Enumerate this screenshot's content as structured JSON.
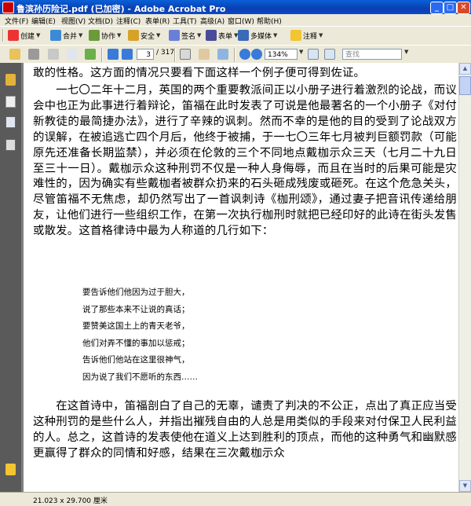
{
  "window": {
    "title": "鲁滨孙历险记.pdf (已加密) - Adobe Acrobat Pro",
    "minimize": "_",
    "maximize": "□",
    "close": "✕"
  },
  "menu": [
    "文件(F)",
    "编辑(E)",
    "视图(V)",
    "文档(D)",
    "注释(C)",
    "表单(R)",
    "工具(T)",
    "高级(A)",
    "窗口(W)",
    "帮助(H)"
  ],
  "toolbar1": {
    "create": "创建",
    "combine": "合并",
    "collaborate": "协作",
    "secure": "安全",
    "sign": "签名",
    "forms": "表单",
    "multimedia": "多媒体",
    "comment": "注释"
  },
  "toolbar2": {
    "page_current": "3",
    "page_total": "/ 317",
    "zoom": "134%",
    "search_placeholder": "查找"
  },
  "document": {
    "paragraphs": [
      "敢的性格。这方面的情况只要看下面这样一个例子便可得到佐证。",
      "　　一七〇二年十二月，英国的两个重要教派间正以小册子进行着激烈的论战，而议会中也正为此事进行着辩论，笛福在此时发表了可说是他最著名的一个小册子《对付新教徒的最简捷办法》，进行了辛辣的讽刺。然而不幸的是他的目的受到了论战双方的误解，在被追逃亡四个月后，他终于被捕，于一七〇三年七月被判巨额罚款（可能原先还准备长期监禁），并必须在伦敦的三个不同地点戴枷示众三天（七月二十九日至三十一日）。戴枷示众这种刑罚不仅是一种人身侮辱，而且在当时的后果可能是灾难性的，因为确实有些戴枷者被群众扔来的石头砸成残废或砸死。在这个危急关头，尽管笛福不无焦虑，却仍然写出了一首讽刺诗《枷刑颂》，通过妻子把音讯传递给朋友，让他们进行一些组织工作，在第一次执行枷刑时就把已经印好的此诗在街头发售或散发。这首格律诗中最为人称道的几行如下："
    ],
    "poem": [
      "要告诉他们他因为过于胆大，",
      "说了那些本来不让说的真话；",
      "要赞美这国土上的青天老爷，",
      "他们对弄不懂的事加以惩戒；",
      "告诉他们他站在这里很神气，",
      "因为说了我们不愿听的东西……"
    ],
    "paragraph_after": "　　在这首诗中，笛福剖白了自己的无辜，谴责了判决的不公正，点出了真正应当受这种刑罚的是些什么人，并指出摧残自由的人总是用类似的手段来对付保卫人民利益的人。总之，这首诗的发表使他在道义上达到胜利的顶点，而他的这种勇气和幽默感更赢得了群众的同情和好感，结果在三次戴枷示众"
  },
  "status": {
    "page_size": "21.023 x 29.700 厘米"
  },
  "colors": {
    "titlebar": "#0a48c8",
    "chrome": "#ece9d8",
    "sidebar": "#5a5a5a",
    "viewer_bg": "#808080"
  },
  "icons": [
    "lock-icon",
    "pages-icon",
    "bookmarks-icon",
    "signatures-icon",
    "comment-icon"
  ]
}
